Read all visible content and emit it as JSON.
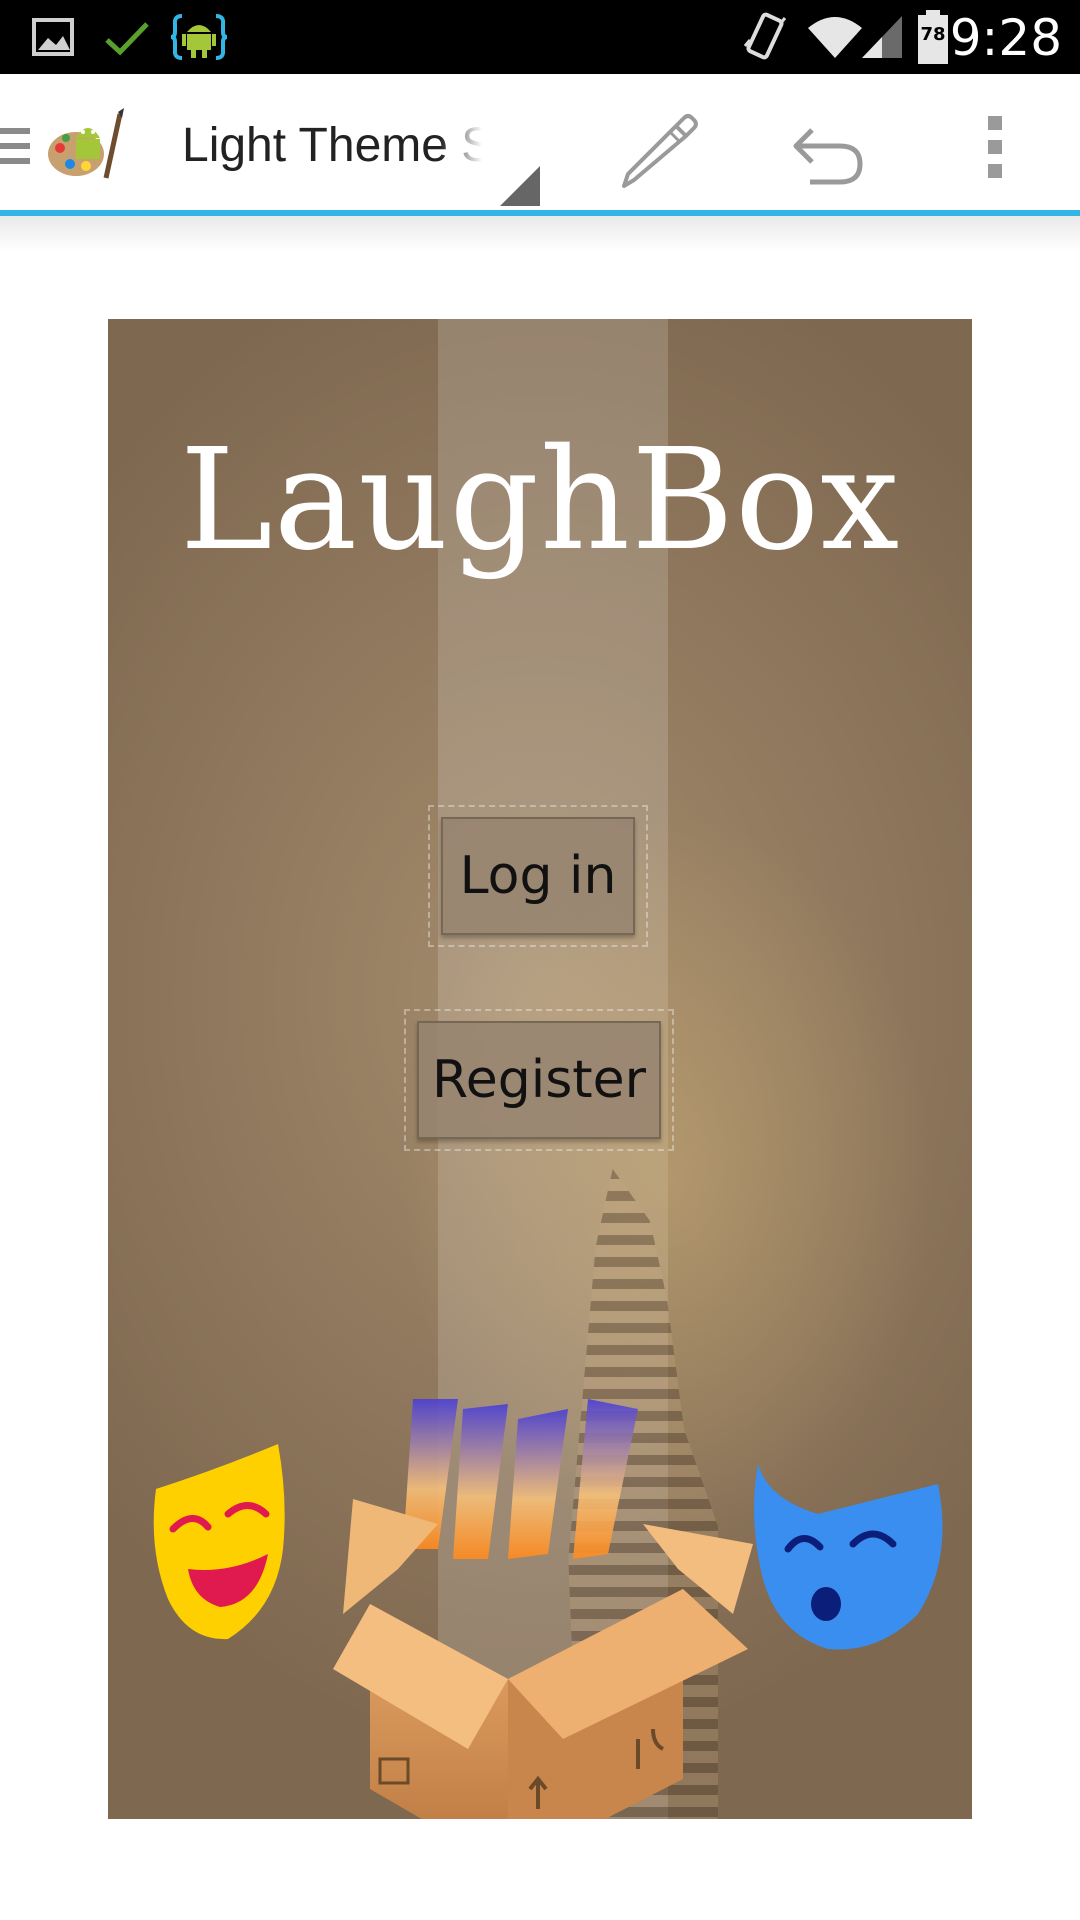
{
  "status_bar": {
    "time": "9:28",
    "battery_level": "78",
    "icons": [
      "gallery-icon",
      "check-icon",
      "android-brackets-icon",
      "vibrate-icon",
      "wifi-icon",
      "signal-icon",
      "battery-icon"
    ],
    "colors": {
      "background": "#000000",
      "check": "#5aa02c",
      "android": "#a4c639",
      "brackets": "#33b5e5"
    }
  },
  "action_bar": {
    "title": "Light Theme S",
    "icons": [
      "menu-icon",
      "app-logo-icon",
      "spinner-indicator",
      "edit-pencil-icon",
      "undo-icon",
      "overflow-menu-icon"
    ],
    "accent_color": "#33b5e5"
  },
  "app": {
    "title": "LaughBox",
    "login_label": "Log in",
    "register_label": "Register",
    "illustration_icons": [
      "comedy-mask-icon",
      "open-box-icon",
      "tragedy-mask-icon"
    ],
    "colors": {
      "comedy_mask": "#ffd000",
      "tragedy_mask": "#3a8ef0",
      "box": "#d9955a"
    }
  }
}
